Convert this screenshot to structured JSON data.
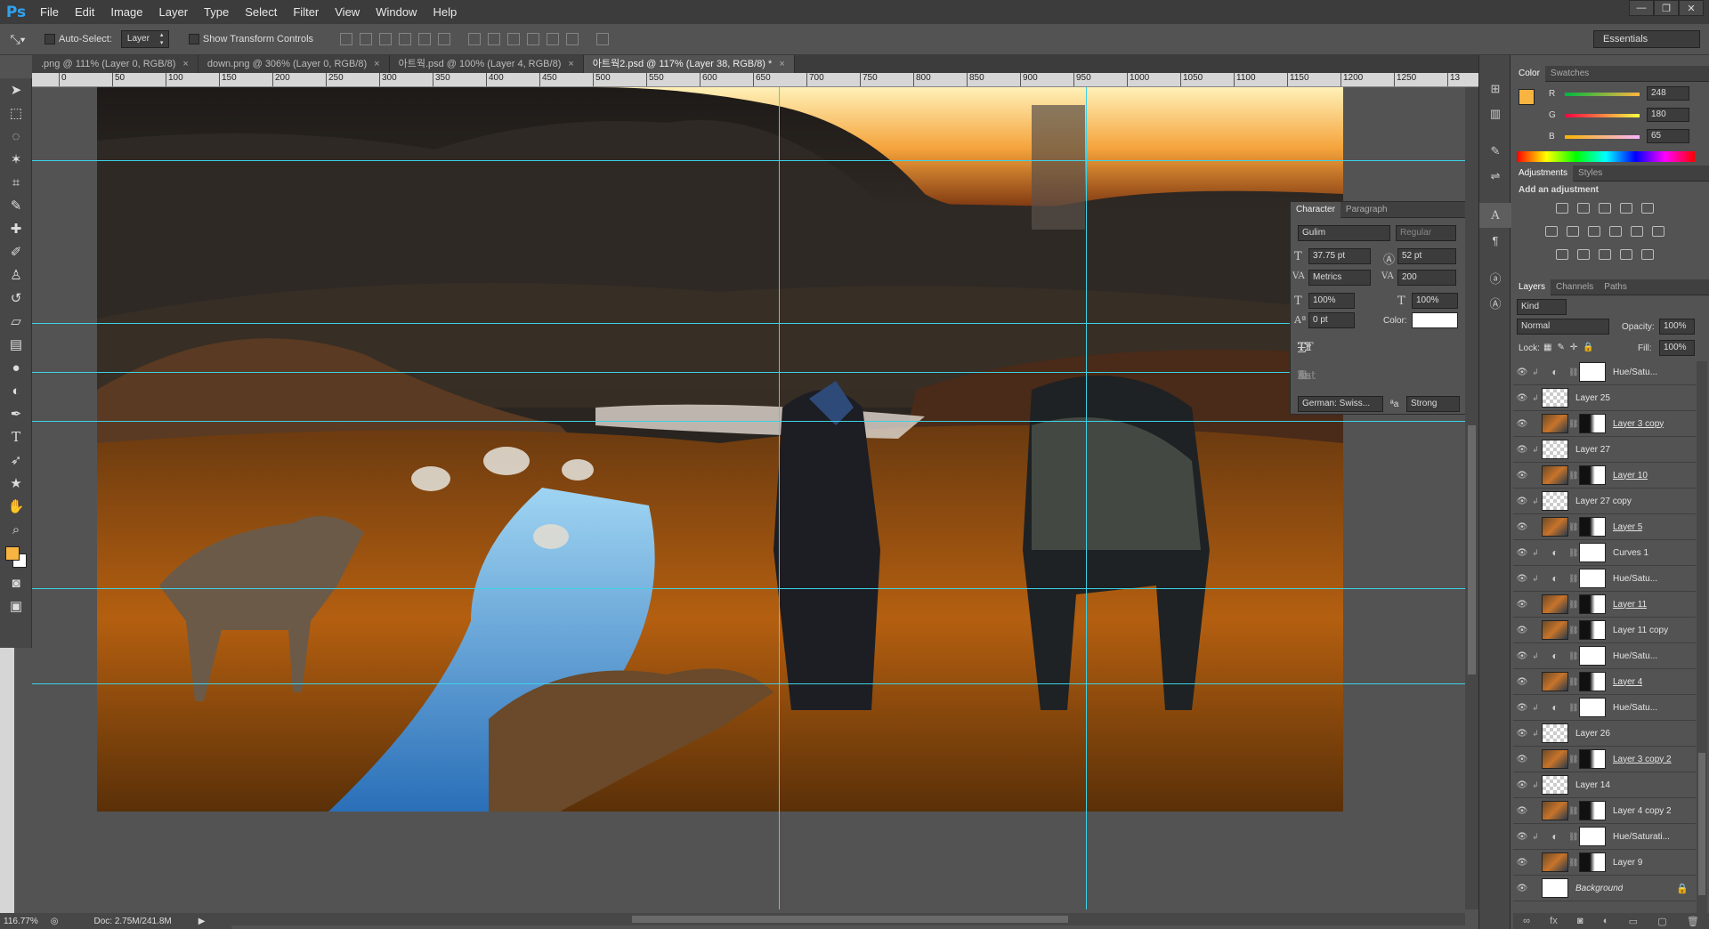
{
  "app": {
    "logo": "Ps"
  },
  "menu": [
    "File",
    "Edit",
    "Image",
    "Layer",
    "Type",
    "Select",
    "Filter",
    "View",
    "Window",
    "Help"
  ],
  "options": {
    "auto_select_label": "Auto-Select:",
    "auto_select_value": "Layer",
    "transform_label": "Show Transform Controls",
    "workspace": "Essentials"
  },
  "tabs": [
    {
      "label": ".png @ 111% (Layer 0, RGB/8)"
    },
    {
      "label": "down.png @ 306% (Layer 0, RGB/8)"
    },
    {
      "label": "아트웍.psd @ 100% (Layer 4, RGB/8)"
    },
    {
      "label": "아트웍2.psd @ 117% (Layer 38, RGB/8) *"
    }
  ],
  "ruler": {
    "h": [
      "50",
      "0",
      "50",
      "100",
      "150",
      "200",
      "250",
      "300",
      "350",
      "400",
      "450",
      "500",
      "550",
      "600",
      "650",
      "700",
      "750",
      "800",
      "850",
      "900",
      "950",
      "1000",
      "1050",
      "1100",
      "1150",
      "1200",
      "1250",
      "13"
    ]
  },
  "status": {
    "zoom": "116.77%",
    "doc": "Doc: 2.75M/241.8M"
  },
  "character": {
    "tabs": [
      "Character",
      "Paragraph"
    ],
    "font": "Gulim",
    "style": "Regular",
    "size": "37.75 pt",
    "leading": "52 pt",
    "kerning": "Metrics",
    "tracking": "200",
    "vscale": "100%",
    "hscale": "100%",
    "baseline": "0 pt",
    "color_label": "Color:",
    "language": "German: Swiss...",
    "aa_label": "ªa",
    "antialias": "Strong",
    "type_styles": [
      "T",
      "T",
      "TT",
      "Tr",
      "T¹",
      "T,",
      "T",
      "T"
    ],
    "ot_styles": [
      "fi",
      "ℰ",
      "st",
      "A",
      "aa",
      "T",
      "1st",
      "½"
    ]
  },
  "color": {
    "tabs": [
      "Color",
      "Swatches"
    ],
    "foreground": "#f8b441",
    "r_label": "R",
    "g_label": "G",
    "b_label": "B",
    "r": 248,
    "g": 180,
    "b": 65
  },
  "adjustments": {
    "tabs": [
      "Adjustments",
      "Styles"
    ],
    "heading": "Add an adjustment"
  },
  "layers": {
    "tabs": [
      "Layers",
      "Channels",
      "Paths"
    ],
    "filter": "Kind",
    "blend": "Normal",
    "opacity_label": "Opacity:",
    "opacity": "100%",
    "lock_label": "Lock:",
    "fill_label": "Fill:",
    "fill": "100%",
    "items": [
      {
        "name": "Hue/Satu...",
        "kind": "adj"
      },
      {
        "name": "Layer 25",
        "kind": "empty"
      },
      {
        "name": "Layer 3 copy",
        "kind": "img",
        "underline": true
      },
      {
        "name": "Layer 27",
        "kind": "empty"
      },
      {
        "name": "Layer 10",
        "kind": "img",
        "underline": true
      },
      {
        "name": "Layer 27 copy",
        "kind": "empty"
      },
      {
        "name": "Layer 5",
        "kind": "img",
        "underline": true
      },
      {
        "name": "Curves 1",
        "kind": "adj"
      },
      {
        "name": "Hue/Satu...",
        "kind": "adj"
      },
      {
        "name": "Layer 11",
        "kind": "img",
        "underline": true
      },
      {
        "name": "Layer 11 copy",
        "kind": "img"
      },
      {
        "name": "Hue/Satu...",
        "kind": "adj"
      },
      {
        "name": "Layer 4",
        "kind": "img",
        "underline": true
      },
      {
        "name": "Hue/Satu...",
        "kind": "adj"
      },
      {
        "name": "Layer 26",
        "kind": "empty"
      },
      {
        "name": "Layer 3 copy 2",
        "kind": "img",
        "underline": true
      },
      {
        "name": "Layer 14",
        "kind": "empty"
      },
      {
        "name": "Layer 4 copy 2",
        "kind": "img"
      },
      {
        "name": "Hue/Saturati...",
        "kind": "adj"
      },
      {
        "name": "Layer 9",
        "kind": "img"
      },
      {
        "name": "Background",
        "kind": "bg",
        "italic": true
      }
    ]
  }
}
